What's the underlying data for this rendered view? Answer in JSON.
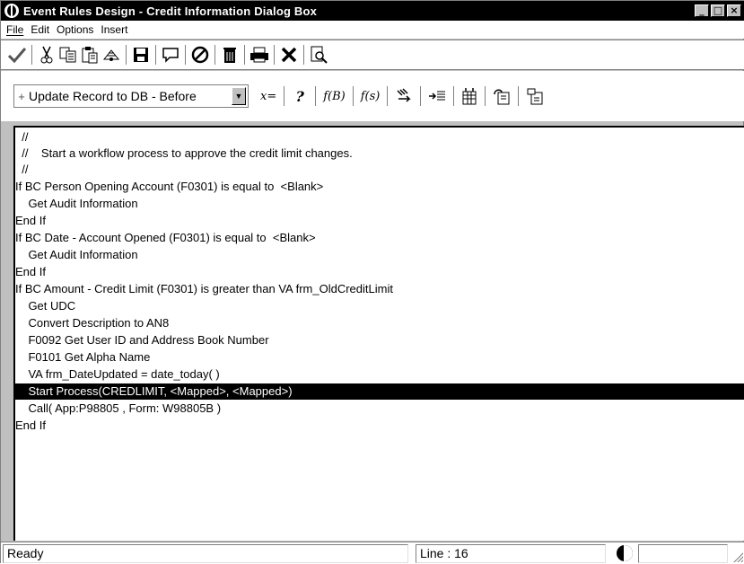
{
  "window": {
    "title": "Event Rules Design - Credit Information Dialog Box",
    "controls": [
      "_",
      "□",
      "×"
    ]
  },
  "menubar": {
    "items": [
      {
        "label": "File",
        "mnemonic": "F"
      },
      {
        "label": "Edit",
        "mnemonic": "E"
      },
      {
        "label": "Options",
        "mnemonic": "O"
      },
      {
        "label": "Insert",
        "mnemonic": "I"
      }
    ]
  },
  "toolbar1": {
    "icons": [
      "check-icon",
      "cut-icon",
      "copy-icon",
      "paste-icon",
      "paste-special-icon",
      "save-icon",
      "comment-icon",
      "cancel-icon",
      "delete-icon",
      "print-icon",
      "close-icon",
      "search-icon"
    ]
  },
  "toolbar2": {
    "event_combo": {
      "prefix": "+",
      "value": "Update Record to DB - Before"
    },
    "assign_label": "x=",
    "if_label": "?",
    "fx_label": "f(B)",
    "fs_label": "f(s)"
  },
  "editor": {
    "lines": [
      "  //",
      "  //    Start a workflow process to approve the credit limit changes.",
      "  //",
      "If BC Person Opening Account (F0301) is equal to  <Blank>",
      "    Get Audit Information",
      "End If",
      "If BC Date - Account Opened (F0301) is equal to  <Blank>",
      "    Get Audit Information",
      "End If",
      "If BC Amount - Credit Limit (F0301) is greater than VA frm_OldCreditLimit",
      "    Get UDC",
      "    Convert Description to AN8",
      "    F0092 Get User ID and Address Book Number",
      "    F0101 Get Alpha Name",
      "    VA frm_DateUpdated = date_today( )",
      "    Start Process(CREDLIMIT, <Mapped>, <Mapped>)",
      "    Call( App:P98805 , Form: W98805B )",
      "End If"
    ],
    "selected_line_index": 15
  },
  "statusbar": {
    "status": "Ready",
    "line": "Line : 16"
  }
}
